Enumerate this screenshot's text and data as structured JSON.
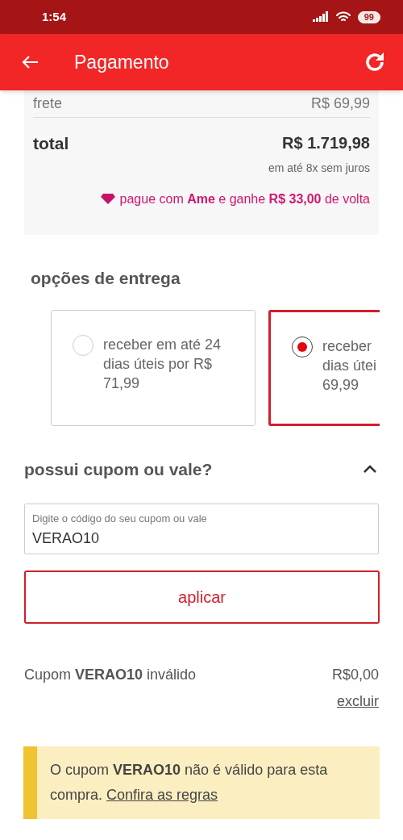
{
  "status_bar": {
    "time": "1:54",
    "battery": "99"
  },
  "header": {
    "title": "Pagamento"
  },
  "summary": {
    "shipping_label": "frete",
    "shipping_value": "R$ 69,99",
    "total_label": "total",
    "total_value": "R$ 1.719,98",
    "installments": "em até 8x sem juros",
    "cashback": "pague com **Ame** e ganhe **R$ 33,00** de volta"
  },
  "delivery": {
    "title": "opções de entrega",
    "options": [
      {
        "lines": [
          "receber em até 24",
          "dias úteis por R$",
          "71,99"
        ],
        "selected": false
      },
      {
        "lines": [
          "receber",
          "dias útei",
          "69,99"
        ],
        "selected": true
      }
    ]
  },
  "coupon": {
    "title": "possui cupom ou vale?",
    "expanded": true,
    "field_label": "Digite o código do seu cupom ou vale",
    "value": "VERAO10",
    "apply_button": "aplicar",
    "result": "Cupom **VERAO10** inválido",
    "result_value": "R$0,00",
    "remove_link": "excluir",
    "alert": "O cupom **VERAO10** não é válido para esta compra.",
    "alert_link": "Confira as regras"
  }
}
